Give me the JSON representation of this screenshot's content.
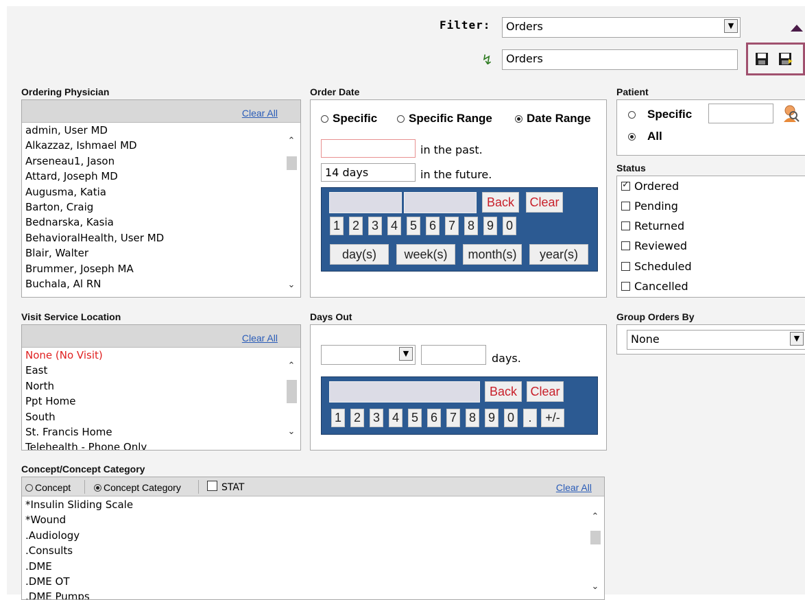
{
  "filter": {
    "label": "Filter:",
    "selected": "Orders",
    "name_value": "Orders",
    "quick_icon": "lightning-icon",
    "toolbar_icons": [
      "save-icon",
      "save-as-icon"
    ],
    "collapse_icon": "triangle-up-icon"
  },
  "ordering_physician": {
    "title": "Ordering Physician",
    "clear_all": "Clear All",
    "items": [
      "admin, User MD",
      "Alkazzaz, Ishmael MD",
      "Arseneau1, Jason",
      "Attard, Joseph MD",
      "Augusma, Katia",
      "Barton, Craig",
      "Bednarska, Kasia",
      "BehavioralHealth, User MD",
      "Blair, Walter",
      "Brummer, Joseph MA",
      "Buchala, Al RN"
    ]
  },
  "order_date": {
    "title": "Order Date",
    "options": [
      "Specific",
      "Specific Range",
      "Date Range"
    ],
    "selected": "Date Range",
    "past_value": "",
    "past_label": "in the past.",
    "future_value": "14 days",
    "future_label": "in the future.",
    "back_label": "Back",
    "clear_label": "Clear",
    "digits": [
      "1",
      "2",
      "3",
      "4",
      "5",
      "6",
      "7",
      "8",
      "9",
      "0"
    ],
    "units": [
      "day(s)",
      "week(s)",
      "month(s)",
      "year(s)"
    ]
  },
  "patient": {
    "title": "Patient",
    "options": [
      "Specific",
      "All"
    ],
    "selected": "All",
    "specific_value": "",
    "search_icon": "person-search-icon"
  },
  "status": {
    "title": "Status",
    "items": [
      {
        "label": "Ordered",
        "checked": true
      },
      {
        "label": "Pending",
        "checked": false
      },
      {
        "label": "Returned",
        "checked": false
      },
      {
        "label": "Reviewed",
        "checked": false
      },
      {
        "label": "Scheduled",
        "checked": false
      },
      {
        "label": "Cancelled",
        "checked": false
      }
    ]
  },
  "visit_service_location": {
    "title": "Visit Service Location",
    "clear_all": "Clear All",
    "items": [
      "None (No Visit)",
      "East",
      "North",
      "Ppt Home",
      "South",
      "St. Francis Home",
      "Telehealth - Phone Only"
    ],
    "highlight_color": "#e02020"
  },
  "days_out": {
    "title": "Days Out",
    "select_value": "",
    "days_value": "",
    "days_label": "days.",
    "back_label": "Back",
    "clear_label": "Clear",
    "digits": [
      "1",
      "2",
      "3",
      "4",
      "5",
      "6",
      "7",
      "8",
      "9",
      "0",
      ".",
      "+/-"
    ]
  },
  "group_orders_by": {
    "title": "Group Orders By",
    "selected": "None"
  },
  "concept": {
    "title": "Concept/Concept Category",
    "options": [
      "Concept",
      "Concept Category"
    ],
    "selected": "Concept Category",
    "stat_label": "STAT",
    "stat_checked": false,
    "clear_all": "Clear All",
    "items": [
      "*Insulin Sliding Scale",
      "*Wound",
      ".Audiology",
      ".Consults",
      ".DME",
      ".DME OT",
      ".DME Pumps"
    ]
  },
  "colors": {
    "keypad_blue": "#2c5a92",
    "link_blue": "#2a5cb8",
    "highlight_border": "#a0506e",
    "panel_bg": "#f3f3f3"
  }
}
